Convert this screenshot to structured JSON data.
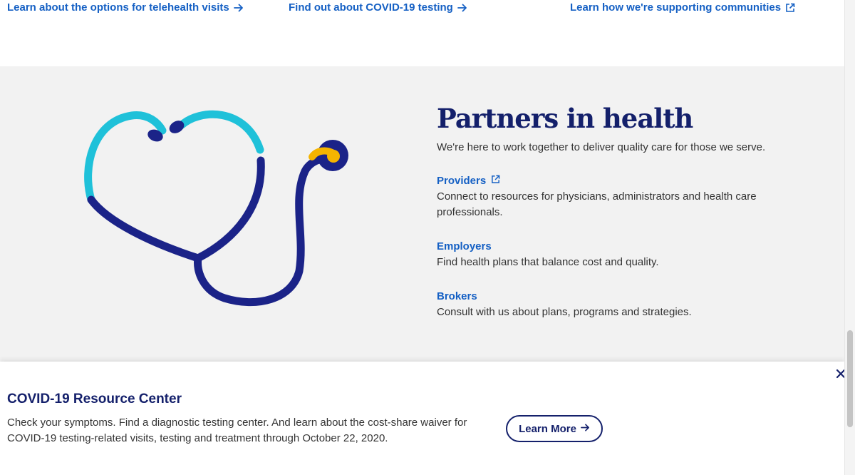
{
  "top_links": [
    {
      "label": "Learn about the options for telehealth visits",
      "icon": "arrow-right-icon"
    },
    {
      "label": "Find out about COVID-19 testing",
      "icon": "arrow-right-icon"
    },
    {
      "label": "Learn how we're supporting communities",
      "icon": "external-link-icon"
    }
  ],
  "partners": {
    "title": "Partners in health",
    "subtitle": "We're here to work together to deliver quality care for those we serve.",
    "illustration": "stethoscope-heart-icon",
    "items": [
      {
        "label": "Providers",
        "icon": "external-link-icon",
        "desc": "Connect to resources for physicians, administrators and health care professionals."
      },
      {
        "label": "Employers",
        "desc": "Find health plans that balance cost and quality."
      },
      {
        "label": "Brokers",
        "desc": "Consult with us about plans, programs and strategies."
      }
    ]
  },
  "banner": {
    "title": "COVID-19 Resource Center",
    "text": "Check your symptoms. Find a diagnostic testing center. And learn about the cost-share waiver for COVID-19 testing-related visits, testing and treatment through October 22, 2020.",
    "button_label": "Learn More",
    "button_icon": "arrow-right-icon",
    "close_icon": "close-icon"
  },
  "colors": {
    "link": "#1560c4",
    "navy": "#14206b",
    "teal": "#1fc1d9",
    "gold": "#f5b400",
    "section_bg": "#f2f2f2"
  }
}
